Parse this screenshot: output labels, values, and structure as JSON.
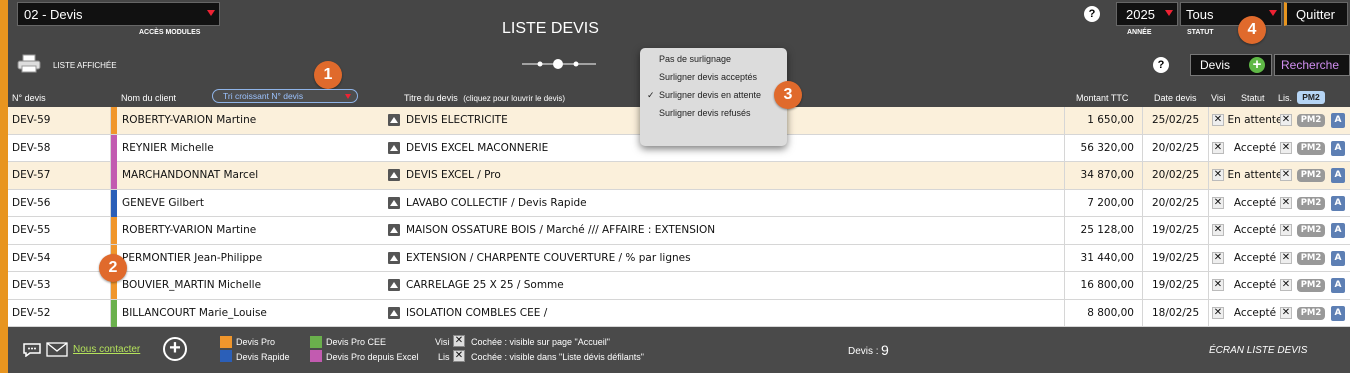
{
  "topbar": {
    "module_select": "02 - Devis",
    "module_caption": "ACCÈS MODULES",
    "page_title": "LISTE DEVIS",
    "help": "?",
    "year_select": "2025",
    "year_caption": "ANNÉE",
    "status_select": "Tous",
    "status_caption": "STATUT",
    "quit_label": "Quitter"
  },
  "toolbar": {
    "liste_affichee": "LISTE AFFICHÉE",
    "help": "?",
    "devis_label": "Devis",
    "add_symbol": "+",
    "recherche_label": "Recherche"
  },
  "badges": [
    "1",
    "2",
    "3",
    "4"
  ],
  "columns": {
    "num": "N° devis",
    "client": "Nom du client",
    "sort_select": "Tri croissant N° devis",
    "titre": "Titre du devis",
    "titre_hint": "(cliquez pour louvrir le devis)",
    "montant": "Montant TTC",
    "date": "Date devis",
    "visi": "Visi",
    "statut": "Statut",
    "lis": "Lis.",
    "pm2": "PM2"
  },
  "highlight_menu": {
    "items": [
      "Pas de surlignage",
      "Surligner devis acceptés",
      "Surligner devis en attente",
      "Surligner devis refusés"
    ],
    "checkmark": "✓",
    "selected_index": 2
  },
  "rows": [
    {
      "num": "DEV-59",
      "client": "ROBERTY-VARION Martine",
      "titre": "DEVIS ELECTRICITE",
      "montant": "1 650,00",
      "date": "25/02/25",
      "statut": "En attente",
      "type_color": "#f0962c",
      "highlight": true
    },
    {
      "num": "DEV-58",
      "client": "REYNIER Michelle",
      "titre": "DEVIS EXCEL MACONNERIE",
      "montant": "56 320,00",
      "date": "20/02/25",
      "statut": "Accepté",
      "type_color": "#c25bb0",
      "highlight": false
    },
    {
      "num": "DEV-57",
      "client": "MARCHANDONNAT Marcel",
      "titre": "DEVIS EXCEL / Pro",
      "montant": "34 870,00",
      "date": "20/02/25",
      "statut": "En attente",
      "type_color": "#c25bb0",
      "highlight": true
    },
    {
      "num": "DEV-56",
      "client": "GENEVE Gilbert",
      "titre": "LAVABO COLLECTIF / Devis Rapide",
      "montant": "7 200,00",
      "date": "20/02/25",
      "statut": "Accepté",
      "type_color": "#2b5fb8",
      "highlight": false
    },
    {
      "num": "DEV-55",
      "client": "ROBERTY-VARION Martine",
      "titre": "MAISON OSSATURE BOIS / Marché  ///  AFFAIRE : EXTENSION",
      "montant": "25 128,00",
      "date": "19/02/25",
      "statut": "Accepté",
      "type_color": "#f0962c",
      "highlight": false
    },
    {
      "num": "DEV-54",
      "client": "PERMONTIER Jean-Philippe",
      "titre": "EXTENSION / CHARPENTE COUVERTURE / % par lignes",
      "montant": "31 440,00",
      "date": "19/02/25",
      "statut": "Accepté",
      "type_color": "#f0962c",
      "highlight": false
    },
    {
      "num": "DEV-53",
      "client": "BOUVIER_MARTIN Michelle",
      "titre": "CARRELAGE 25 X 25 / Somme",
      "montant": "16 800,00",
      "date": "19/02/25",
      "statut": "Accepté",
      "type_color": "#f0962c",
      "highlight": false
    },
    {
      "num": "DEV-52",
      "client": "BILLANCOURT Marie_Louise",
      "titre": "ISOLATION COMBLES CEE /",
      "montant": "8 800,00",
      "date": "18/02/25",
      "statut": "Accepté",
      "type_color": "#6ab04c",
      "highlight": false
    }
  ],
  "row_marks": {
    "x": "✕",
    "pm2": "PM2",
    "a": "A"
  },
  "footer": {
    "contact_label": "Nous contacter",
    "legend": [
      {
        "label": "Devis Pro",
        "color": "#f0962c"
      },
      {
        "label": "Devis Rapide",
        "color": "#2b5fb8"
      },
      {
        "label": "Devis Pro CEE",
        "color": "#6ab04c"
      },
      {
        "label": "Devis Pro depuis Excel",
        "color": "#c25bb0"
      }
    ],
    "visi_label": "Visi",
    "visi_desc": "Cochée : visible sur page \"Accueil\"",
    "lis_label": "Lis",
    "lis_desc": "Cochée : visible dans \"Liste dévis défilants\"",
    "count_label": "Devis :",
    "count_value": "9",
    "screen_label": "ÉCRAN LISTE DEVIS"
  }
}
